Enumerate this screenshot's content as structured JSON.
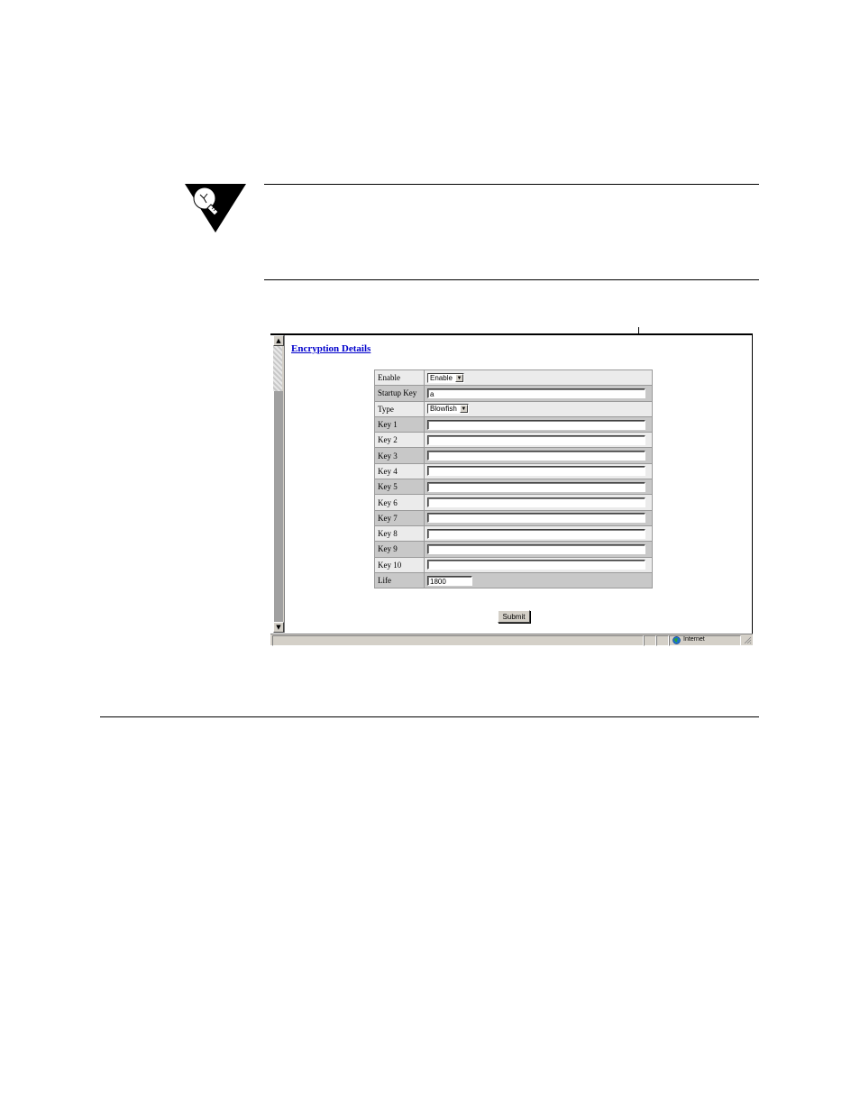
{
  "screenshot": {
    "heading": "Encryption Details",
    "form": {
      "rows": [
        {
          "label": "Enable",
          "kind": "select",
          "value": "Enable"
        },
        {
          "label": "Startup Key",
          "kind": "text",
          "value": "a"
        },
        {
          "label": "Type",
          "kind": "select",
          "value": "Blowfish"
        },
        {
          "label": "Key 1",
          "kind": "text",
          "value": ""
        },
        {
          "label": "Key 2",
          "kind": "text",
          "value": ""
        },
        {
          "label": "Key 3",
          "kind": "text",
          "value": ""
        },
        {
          "label": "Key 4",
          "kind": "text",
          "value": ""
        },
        {
          "label": "Key 5",
          "kind": "text",
          "value": ""
        },
        {
          "label": "Key 6",
          "kind": "text",
          "value": ""
        },
        {
          "label": "Key 7",
          "kind": "text",
          "value": ""
        },
        {
          "label": "Key 8",
          "kind": "text",
          "value": ""
        },
        {
          "label": "Key 9",
          "kind": "text",
          "value": ""
        },
        {
          "label": "Key 10",
          "kind": "text",
          "value": ""
        },
        {
          "label": "Life",
          "kind": "text-short",
          "value": "1800"
        }
      ]
    },
    "submit_label": "Submit",
    "status": {
      "zone": "Internet",
      "zone_icon": "globe-icon"
    }
  },
  "icons": {
    "note": "lightbulb-note-icon"
  },
  "colors": {
    "heading_link": "#0000cc",
    "row_light": "#ebebeb",
    "row_dark": "#c8c8c8",
    "chrome": "#d4d0c8"
  }
}
